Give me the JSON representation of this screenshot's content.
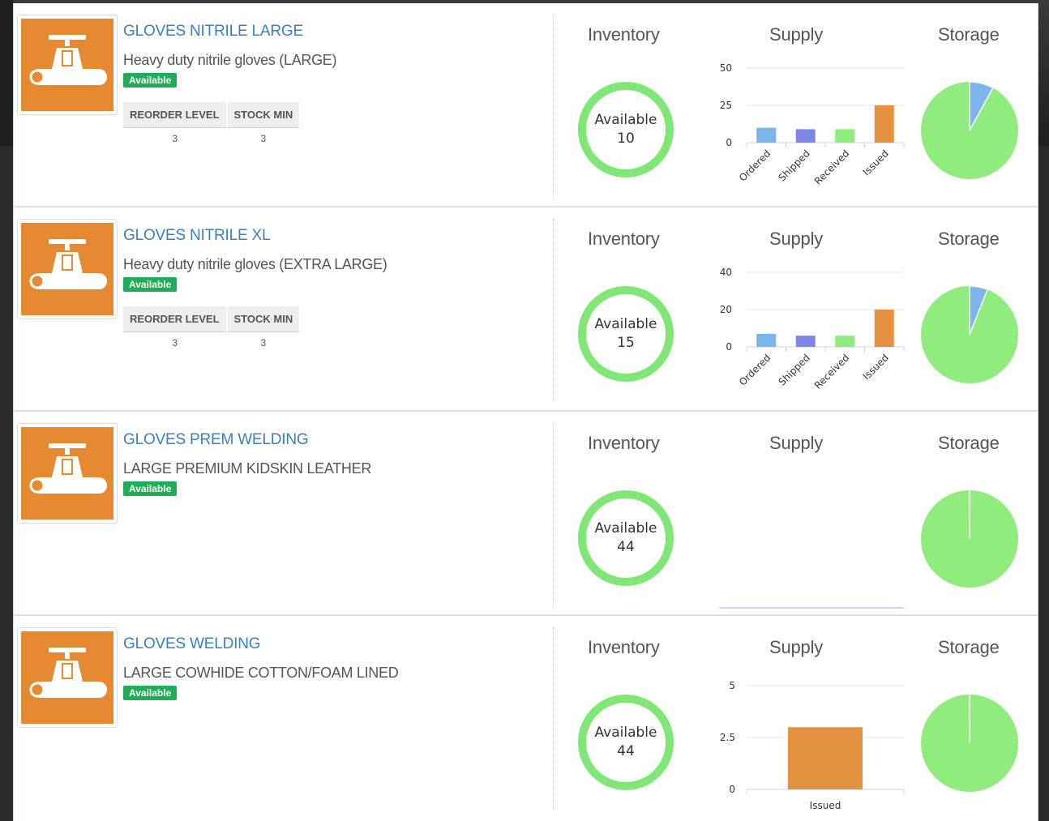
{
  "headers": {
    "inventory": "Inventory",
    "supply": "Supply",
    "storage": "Storage"
  },
  "colors": {
    "accent": "#3a7fc0",
    "badge": "#1fad57",
    "ring": "#80e676",
    "thumb": "#e58a32",
    "ordered": "#7cb5ec",
    "shipped": "#8085e9",
    "received": "#90ed7d",
    "issued": "#e4923f"
  },
  "items": [
    {
      "title": "GLOVES NITRILE LARGE",
      "description": "Heavy duty nitrile gloves (LARGE)",
      "status": "Available",
      "levels": {
        "reorder_label": "REORDER LEVEL",
        "stock_label": "STOCK MIN",
        "reorder": "3",
        "stock": "3"
      },
      "available_label": "Available",
      "available": "10",
      "storage_fraction": 0.08,
      "chart_data": {
        "type": "bar",
        "categories": [
          "Ordered",
          "Shipped",
          "Received",
          "Issued"
        ],
        "values": [
          10,
          9,
          9,
          25
        ],
        "yticks": [
          "0",
          "25",
          "50"
        ],
        "ylim": [
          0,
          50
        ]
      }
    },
    {
      "title": "GLOVES NITRILE XL",
      "description": "Heavy duty nitrile gloves (EXTRA LARGE)",
      "status": "Available",
      "levels": {
        "reorder_label": "REORDER LEVEL",
        "stock_label": "STOCK MIN",
        "reorder": "3",
        "stock": "3"
      },
      "available_label": "Available",
      "available": "15",
      "storage_fraction": 0.06,
      "chart_data": {
        "type": "bar",
        "categories": [
          "Ordered",
          "Shipped",
          "Received",
          "Issued"
        ],
        "values": [
          7,
          6,
          6,
          20
        ],
        "yticks": [
          "0",
          "20",
          "40"
        ],
        "ylim": [
          0,
          40
        ]
      }
    },
    {
      "title": "GLOVES PREM WELDING",
      "description": "LARGE PREMIUM KIDSKIN LEATHER",
      "status": "Available",
      "available_label": "Available",
      "available": "44",
      "storage_fraction": 0.001,
      "chart_data": {
        "type": "bar",
        "categories": [],
        "values": [],
        "yticks": [],
        "ylim": [
          0,
          1
        ]
      }
    },
    {
      "title": "GLOVES WELDING",
      "description": "LARGE COWHIDE COTTON/FOAM LINED",
      "status": "Available",
      "available_label": "Available",
      "available": "44",
      "storage_fraction": 0.001,
      "chart_data": {
        "type": "bar",
        "categories": [
          "Issued"
        ],
        "values": [
          3
        ],
        "yticks": [
          "0",
          "2.5",
          "5"
        ],
        "ylim": [
          0,
          5
        ]
      }
    }
  ]
}
